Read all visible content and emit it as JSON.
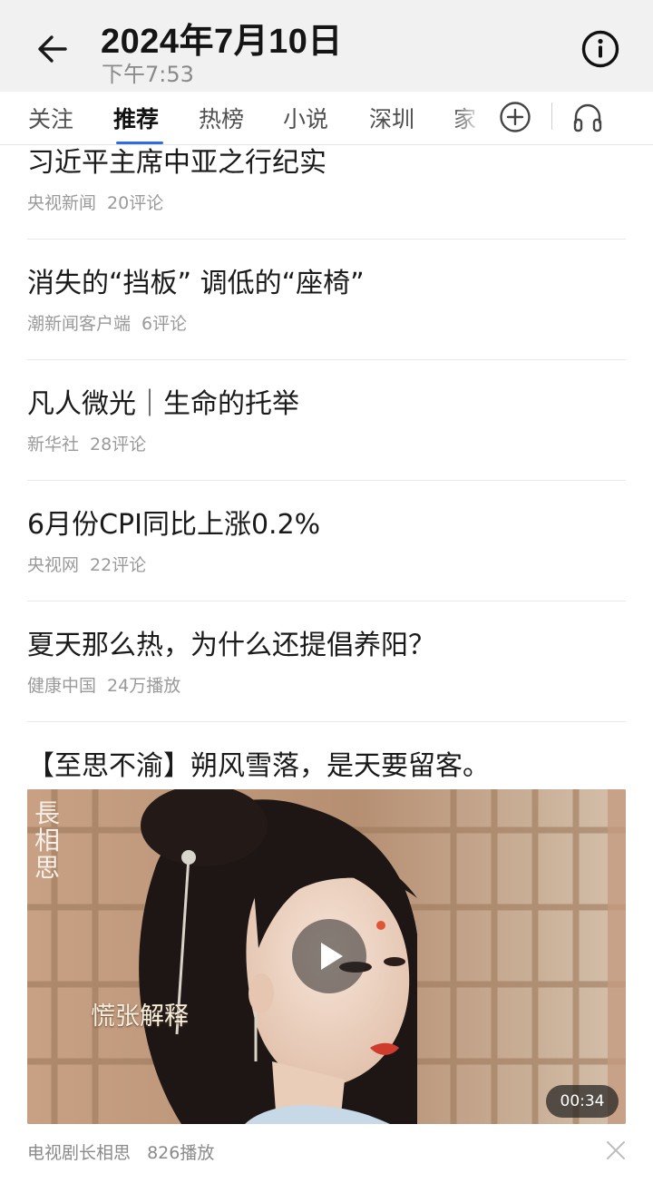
{
  "header": {
    "title": "2024年7月10日",
    "subtitle": "下午7:53",
    "back_icon": "arrow-left-icon",
    "info_icon": "info-circle-icon"
  },
  "tabs": {
    "items": [
      {
        "label": "关注",
        "active": false
      },
      {
        "label": "推荐",
        "active": true
      },
      {
        "label": "热榜",
        "active": false
      },
      {
        "label": "小说",
        "active": false
      },
      {
        "label": "深圳",
        "active": false
      },
      {
        "label": "家",
        "active": false
      }
    ],
    "add_icon": "plus-circle-icon",
    "listen_icon": "headphones-icon",
    "accent_color": "#2e6be6"
  },
  "feed": [
    {
      "headline": "习近平主席中亚之行纪实",
      "source": "央视新闻",
      "stat": "20评论"
    },
    {
      "headline": "消失的“挡板” 调低的“座椅”",
      "source": "潮新闻客户端",
      "stat": "6评论"
    },
    {
      "headline": "凡人微光｜生命的托举",
      "source": "新华社",
      "stat": "28评论"
    },
    {
      "headline": "6月份CPI同比上涨0.2%",
      "source": "央视网",
      "stat": "22评论"
    },
    {
      "headline": "夏天那么热，为什么还提倡养阳？",
      "source": "健康中国",
      "stat": "24万播放"
    }
  ],
  "video": {
    "headline": "【至思不渝】朔风雪落，是天要留客。",
    "thumbnail_logo": "長相思",
    "thumbnail_caption": "慌张解释",
    "duration": "00:34",
    "source": "电视剧长相思",
    "stat": "826播放",
    "play_icon": "play-icon",
    "dismiss_icon": "close-icon"
  }
}
